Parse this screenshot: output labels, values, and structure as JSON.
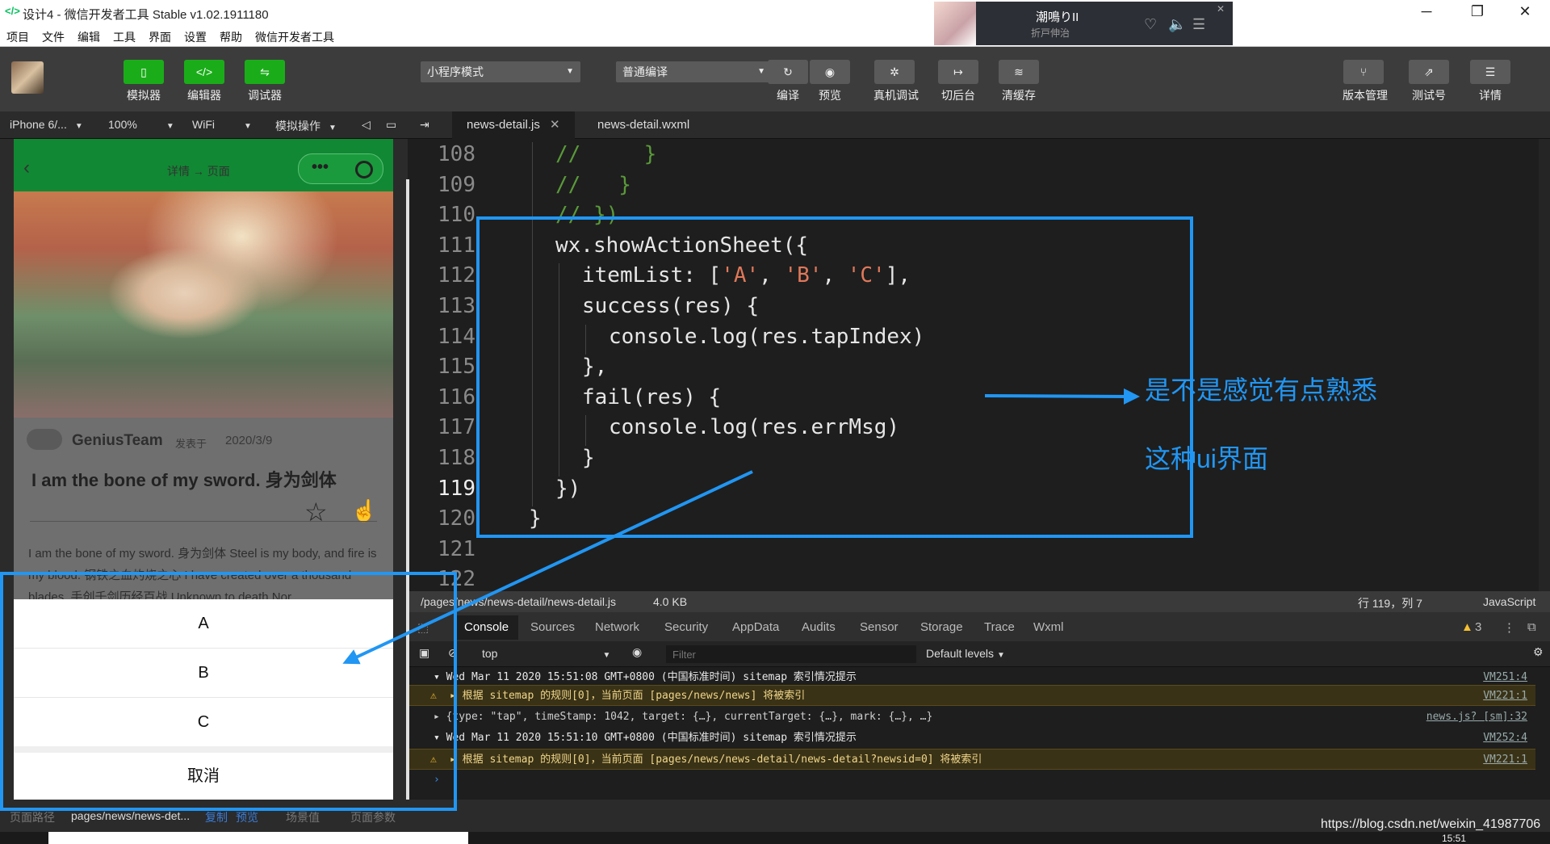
{
  "window": {
    "title": "设计4 - 微信开发者工具 Stable v1.02.1911180",
    "logo": "</>",
    "controls": [
      "─",
      "❐",
      "✕"
    ]
  },
  "menu": [
    "项目",
    "文件",
    "编辑",
    "工具",
    "界面",
    "设置",
    "帮助",
    "微信开发者工具"
  ],
  "music": {
    "song": "潮鳴りII",
    "artist": "折戸伸治"
  },
  "toolbar": {
    "left_buttons": [
      {
        "label": "模拟器",
        "icon": "phone-icon",
        "glyph": "▯"
      },
      {
        "label": "编辑器",
        "icon": "code-icon",
        "glyph": "</>"
      },
      {
        "label": "调试器",
        "icon": "debug-icon",
        "glyph": "⇋"
      }
    ],
    "mode_select": "小程序模式",
    "compile_select": "普通编译",
    "mid_buttons": [
      {
        "label": "编译",
        "icon": "refresh-icon",
        "glyph": "↻"
      },
      {
        "label": "预览",
        "icon": "eye-icon",
        "glyph": "◉"
      },
      {
        "label": "真机调试",
        "icon": "bug-icon",
        "glyph": "✲"
      },
      {
        "label": "切后台",
        "icon": "switch-icon",
        "glyph": "↦"
      },
      {
        "label": "清缓存",
        "icon": "layers-icon",
        "glyph": "≋"
      }
    ],
    "right_buttons": [
      {
        "label": "版本管理",
        "icon": "branch-icon",
        "glyph": "⑂"
      },
      {
        "label": "测试号",
        "icon": "external-icon",
        "glyph": "⇗"
      },
      {
        "label": "详情",
        "icon": "menu-icon",
        "glyph": "☰"
      }
    ]
  },
  "simbar": {
    "device": "iPhone 6/...",
    "zoom": "100%",
    "network": "WiFi",
    "ops": "模拟操作"
  },
  "tabs": [
    {
      "label": "news-detail.js",
      "close": "✕",
      "active": true
    },
    {
      "label": "news-detail.wxml",
      "active": false
    }
  ],
  "phone": {
    "nav_title": "详情 → 页面",
    "back": "‹",
    "capsule_dots": "•••",
    "author": "GeniusTeam",
    "published_label": "发表于",
    "date": "2020/3/9",
    "article_title": "I am the bone of my sword. 身为剑体",
    "star": "☆",
    "hand": "☝",
    "body": "I am the bone of my sword. 身为剑体 Steel is my body, and fire is my blood. 钢铁之血灼烧之心 I have created over a thousand blades. 手创千剑历经百战 Unknown to death.Nor",
    "sheet_items": [
      "A",
      "B",
      "C"
    ],
    "sheet_cancel": "取消"
  },
  "editor": {
    "lines": [
      {
        "n": "108",
        "indent": 2,
        "parts": [
          {
            "t": "//     }",
            "c": "cm"
          }
        ]
      },
      {
        "n": "109",
        "indent": 2,
        "parts": [
          {
            "t": "//   }",
            "c": "cm"
          }
        ]
      },
      {
        "n": "110",
        "indent": 2,
        "parts": [
          {
            "t": "// })",
            "c": "cm"
          }
        ]
      },
      {
        "n": "111",
        "indent": 2,
        "parts": [
          {
            "t": "wx.showActionSheet({",
            "c": ""
          }
        ]
      },
      {
        "n": "112",
        "indent": 3,
        "parts": [
          {
            "t": "itemList: [",
            "c": ""
          },
          {
            "t": "'A'",
            "c": "st"
          },
          {
            "t": ", ",
            "c": ""
          },
          {
            "t": "'B'",
            "c": "st"
          },
          {
            "t": ", ",
            "c": ""
          },
          {
            "t": "'C'",
            "c": "st"
          },
          {
            "t": "],",
            "c": ""
          }
        ]
      },
      {
        "n": "113",
        "indent": 3,
        "parts": [
          {
            "t": "success(res) {",
            "c": ""
          }
        ]
      },
      {
        "n": "114",
        "indent": 4,
        "parts": [
          {
            "t": "console.log(res.tapIndex)",
            "c": ""
          }
        ]
      },
      {
        "n": "115",
        "indent": 3,
        "parts": [
          {
            "t": "},",
            "c": ""
          }
        ]
      },
      {
        "n": "116",
        "indent": 3,
        "parts": [
          {
            "t": "fail(res) {",
            "c": ""
          }
        ]
      },
      {
        "n": "117",
        "indent": 4,
        "parts": [
          {
            "t": "console.log(res.errMsg)",
            "c": ""
          }
        ]
      },
      {
        "n": "118",
        "indent": 3,
        "parts": [
          {
            "t": "}",
            "c": ""
          }
        ]
      },
      {
        "n": "119",
        "indent": 2,
        "parts": [
          {
            "t": "})",
            "c": ""
          }
        ],
        "current": true
      },
      {
        "n": "120",
        "indent": 1,
        "parts": [
          {
            "t": "}",
            "c": ""
          }
        ]
      },
      {
        "n": "121",
        "indent": 0,
        "parts": []
      },
      {
        "n": "122",
        "indent": 0,
        "parts": []
      }
    ]
  },
  "status": {
    "path": "/pages/news/news-detail/news-detail.js",
    "size": "4.0 KB",
    "position": "行 119，列 7",
    "language": "JavaScript"
  },
  "devtools": {
    "tabs": [
      "Console",
      "Sources",
      "Network",
      "Security",
      "AppData",
      "Audits",
      "Sensor",
      "Storage",
      "Trace",
      "Wxml"
    ],
    "warn_count": "3",
    "context": "top",
    "filter_placeholder": "Filter",
    "levels": "Default levels"
  },
  "console_rows": [
    {
      "type": "group",
      "text": "▾ Wed Mar 11 2020 15:51:08 GMT+0800 (中国标准时间) sitemap 索引情况提示",
      "src": "VM251:4"
    },
    {
      "type": "warn",
      "text": "▸ 根据 sitemap 的规则[0]，当前页面 [pages/news/news] 将被索引",
      "src": "VM221:1"
    },
    {
      "type": "log",
      "text": "▸ {type: \"tap\", timeStamp: 1042, target: {…}, currentTarget: {…}, mark: {…}, …}",
      "src": "news.js? [sm]:32"
    },
    {
      "type": "group",
      "text": "▾ Wed Mar 11 2020 15:51:10 GMT+0800 (中国标准时间) sitemap 索引情况提示",
      "src": "VM252:4"
    },
    {
      "type": "warn",
      "text": "▸ 根据 sitemap 的规则[0]，当前页面 [pages/news/news-detail/news-detail?newsid=0] 将被索引",
      "src": "VM221:1"
    },
    {
      "type": "prompt",
      "text": "›",
      "src": ""
    }
  ],
  "pathbar": {
    "label": "页面路径",
    "path": "pages/news/news-det...",
    "copy": "复制",
    "preview": "预览",
    "scene": "场景值",
    "params": "页面参数"
  },
  "annotations": {
    "line1": "是不是感觉有点熟悉",
    "line2": "这种ui界面",
    "accent": "#2196f3"
  },
  "watermark": "https://blog.csdn.net/weixin_41987706",
  "clock": "15:51"
}
